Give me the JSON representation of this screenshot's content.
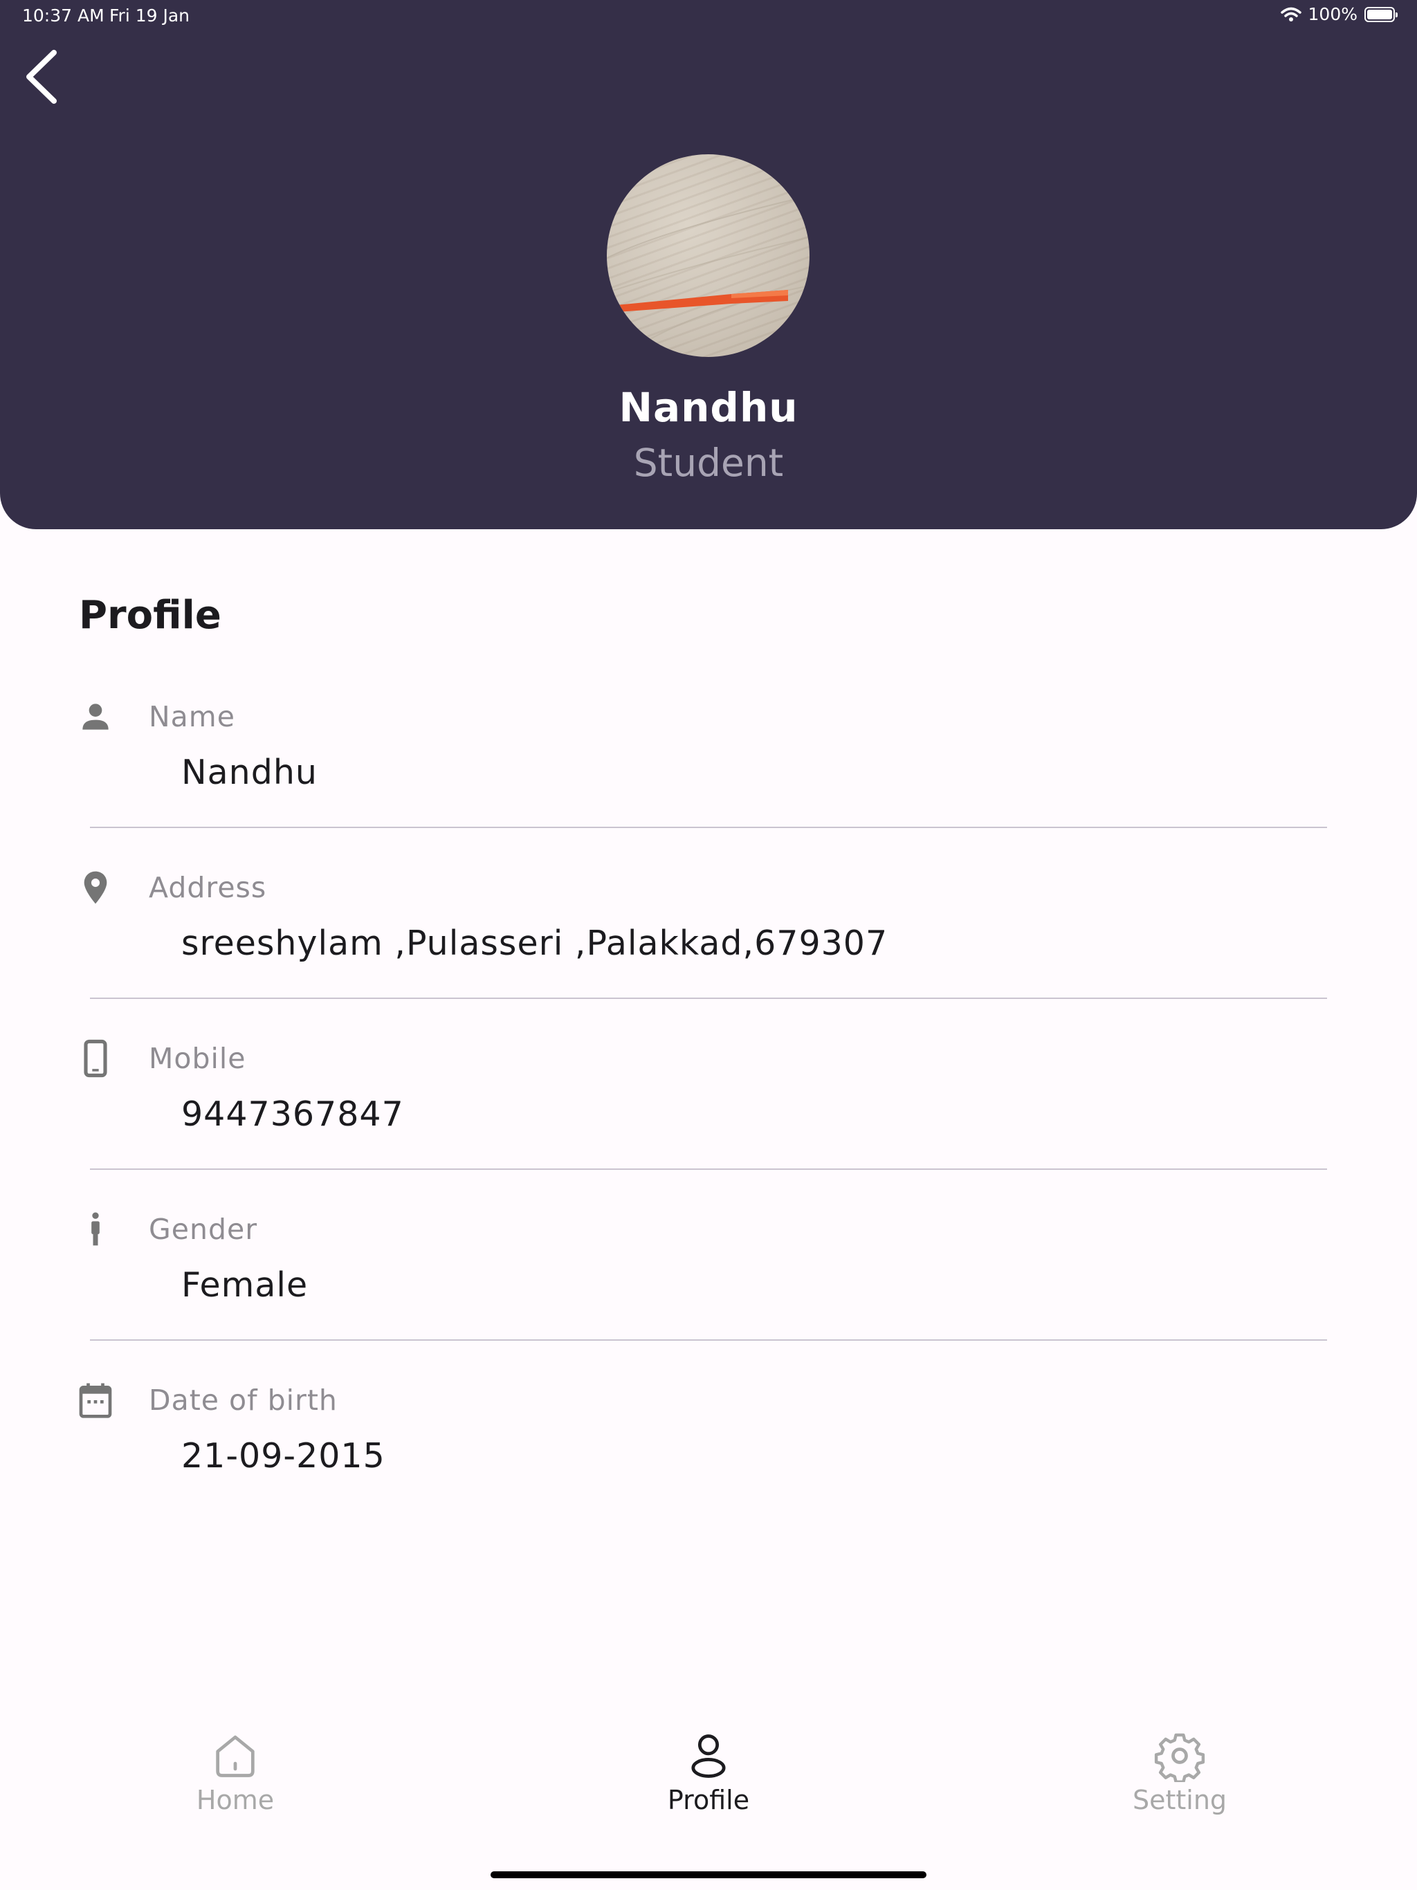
{
  "status_bar": {
    "time": "10:37 AM",
    "date": "Fri 19 Jan",
    "battery": "100%"
  },
  "header": {
    "name": "Nandhu",
    "role": "Student"
  },
  "profile": {
    "title": "Profile",
    "fields": [
      {
        "label": "Name",
        "value": "Nandhu",
        "icon": "person-icon"
      },
      {
        "label": "Address",
        "value": "sreeshylam ,Pulasseri ,Palakkad,679307",
        "icon": "location-pin-icon"
      },
      {
        "label": "Mobile",
        "value": "9447367847",
        "icon": "phone-icon"
      },
      {
        "label": "Gender",
        "value": "Female",
        "icon": "standing-person-icon"
      },
      {
        "label": "Date of birth",
        "value": "21-09-2015",
        "icon": "calendar-icon"
      }
    ]
  },
  "nav": {
    "items": [
      {
        "label": "Home",
        "icon": "home-icon",
        "active": false
      },
      {
        "label": "Profile",
        "icon": "profile-icon",
        "active": true
      },
      {
        "label": "Setting",
        "icon": "gear-icon",
        "active": false
      }
    ]
  },
  "colors": {
    "header_bg": "#352f48",
    "page_bg": "#fffbfe",
    "accent_pen": "#e8552a"
  }
}
